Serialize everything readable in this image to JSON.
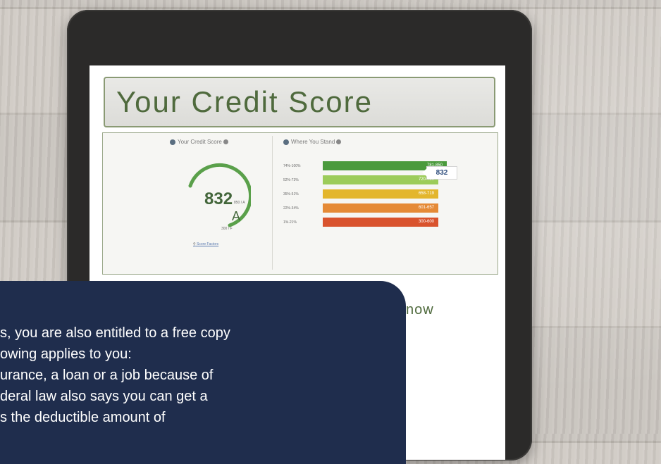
{
  "screen": {
    "title": "Your Credit Score",
    "left_panel": {
      "heading": "Your Credit Score",
      "score": "832",
      "grade": "A",
      "max_label": "850 / A",
      "min_label": "300 / F",
      "link_label": "Score Factors"
    },
    "right_panel": {
      "heading": "Where You Stand",
      "current_score_flag": "832",
      "bands": [
        {
          "percent": "74%-100%",
          "range": "781-850",
          "color": "#4a9a3c"
        },
        {
          "percent": "52%-73%",
          "range": "720-780",
          "color": "#9ccc5a"
        },
        {
          "percent": "35%-51%",
          "range": "658-719",
          "color": "#e3b62c"
        },
        {
          "percent": "22%-34%",
          "range": "601-657",
          "color": "#e58a36"
        },
        {
          "percent": "1%-21%",
          "range": "300-600",
          "color": "#d9532d"
        }
      ]
    },
    "partial_heading": "now"
  },
  "overlay": {
    "lines": [
      "s, you are also entitled to a free copy",
      "owing applies to you:",
      "urance, a loan or a job because of",
      "deral law also says you can get a",
      "s the deductible amount of"
    ]
  },
  "colors": {
    "overlay_bg": "#1f2d4d",
    "title_green": "#4f6a3d",
    "gauge_green": "#5aa04a"
  }
}
